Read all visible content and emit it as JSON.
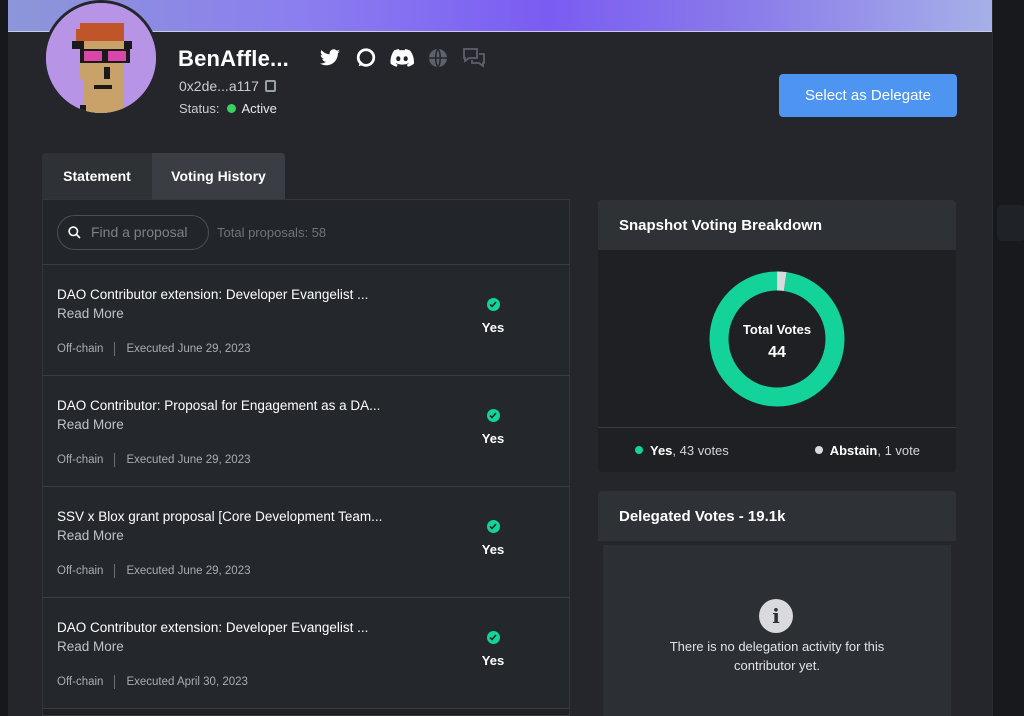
{
  "profile": {
    "name": "BenAffle...",
    "address": "0x2de...a117",
    "status_label": "Status:",
    "status_value": "Active",
    "socials": [
      "twitter-icon",
      "discourse-icon",
      "discord-icon",
      "globe-icon",
      "forum-icon"
    ]
  },
  "actions": {
    "delegate_label": "Select as Delegate"
  },
  "tabs": [
    {
      "label": "Statement"
    },
    {
      "label": "Voting History"
    }
  ],
  "search": {
    "placeholder": "Find a proposal",
    "total": "Total proposals: 58"
  },
  "proposals": [
    {
      "title": "DAO Contributor extension: Developer Evangelist ...",
      "more": "Read More",
      "chain": "Off-chain",
      "executed": "Executed June 29, 2023",
      "vote": "Yes"
    },
    {
      "title": "DAO Contributor: Proposal for Engagement as a DA...",
      "more": "Read More",
      "chain": "Off-chain",
      "executed": "Executed June 29, 2023",
      "vote": "Yes"
    },
    {
      "title": "SSV x Blox grant proposal [Core Development Team...",
      "more": "Read More",
      "chain": "Off-chain",
      "executed": "Executed June 29, 2023",
      "vote": "Yes"
    },
    {
      "title": "DAO Contributor extension: Developer Evangelist ...",
      "more": "Read More",
      "chain": "Off-chain",
      "executed": "Executed April 30, 2023",
      "vote": "Yes"
    }
  ],
  "breakdown": {
    "title": "Snapshot Voting Breakdown",
    "center_label": "Total Votes",
    "total": "44",
    "yes_votes": 43,
    "abstain_votes": 1,
    "yes_label": "Yes",
    "yes_count": ", 43 votes",
    "abstain_label": "Abstain",
    "abstain_count": ", 1 vote",
    "colors": {
      "yes": "#13d39b",
      "abstain": "#d9dadd"
    }
  },
  "delegated": {
    "title": "Delegated Votes - 19.1k",
    "empty_text": "There is no delegation activity for this contributor yet."
  }
}
